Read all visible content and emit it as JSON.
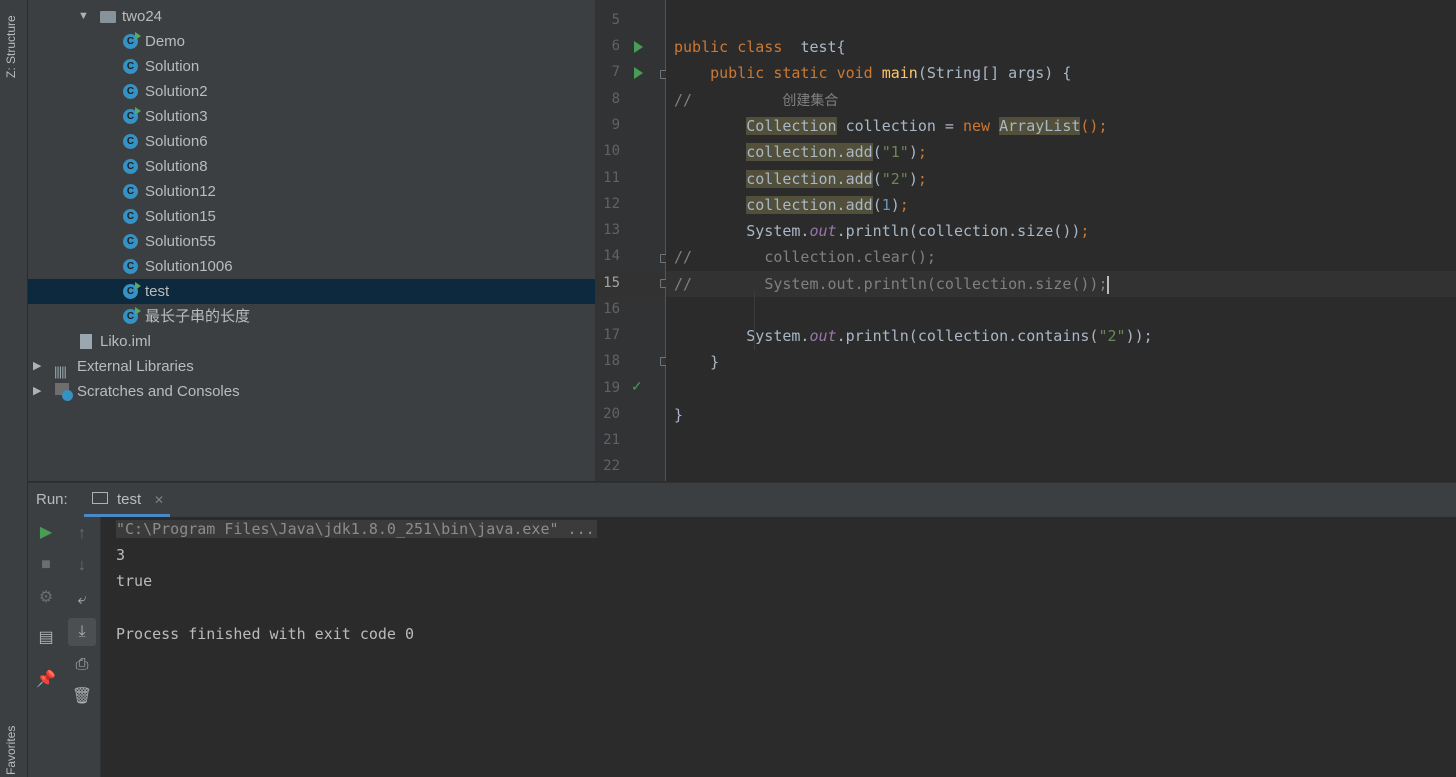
{
  "tool_strip": {
    "structure_label": "Z: Structure",
    "favorites_label": "Favorites"
  },
  "project_tree": {
    "folder": "two24",
    "files": [
      "Demo",
      "Solution",
      "Solution2",
      "Solution3",
      "Solution6",
      "Solution8",
      "Solution12",
      "Solution15",
      "Solution55",
      "Solution1006",
      "test",
      "最长子串的长度"
    ],
    "selected": "test",
    "iml": "Liko.iml",
    "external_libraries": "External Libraries",
    "scratches": "Scratches and Consoles"
  },
  "editor": {
    "line_numbers": [
      "5",
      "6",
      "7",
      "8",
      "9",
      "10",
      "11",
      "12",
      "13",
      "14",
      "15",
      "16",
      "17",
      "18",
      "19",
      "20",
      "21",
      "22"
    ],
    "current_line": "15",
    "code": {
      "l6_public": "public",
      "l6_class": "class",
      "l6_name": "test{",
      "l7_public": "public",
      "l7_static": "static",
      "l7_void": "void",
      "l7_main": "main",
      "l7_args": "(String[] args) {",
      "l8_comment": "//",
      "l8_text": "创建集合",
      "l9_type": "Collection",
      "l9_var": " collection = ",
      "l9_new": "new",
      "l9_impl": "ArrayList",
      "l9_end": "();",
      "l10_call": "collection.add",
      "l10_arg": "\"1\"",
      "l11_call": "collection.add",
      "l11_arg": "\"2\"",
      "l12_call": "collection.add",
      "l12_arg": "1",
      "l13_sys": "System.",
      "l13_out": "out",
      "l13_rest": ".println(collection.size())",
      "l14_comment": "//",
      "l14_text": "collection.clear();",
      "l15_comment": "//",
      "l15_text": "System.out.println(collection.size());",
      "l17_sys": "System.",
      "l17_out": "out",
      "l17_rest": ".println(collection.contains(",
      "l17_arg": "\"2\"",
      "l17_end": "));",
      "l18_brace": "}",
      "l20_brace": "}"
    }
  },
  "run_panel": {
    "label": "Run:",
    "tab": "test",
    "tab_close": "✕",
    "console": {
      "command": "\"C:\\Program Files\\Java\\jdk1.8.0_251\\bin\\java.exe\" ...",
      "out1": "3",
      "out2": "true",
      "finish": "Process finished with exit code 0"
    }
  },
  "colors": {
    "accent_run": "#499c54",
    "selection": "#0d293e",
    "class_icon": "#3592c4"
  }
}
